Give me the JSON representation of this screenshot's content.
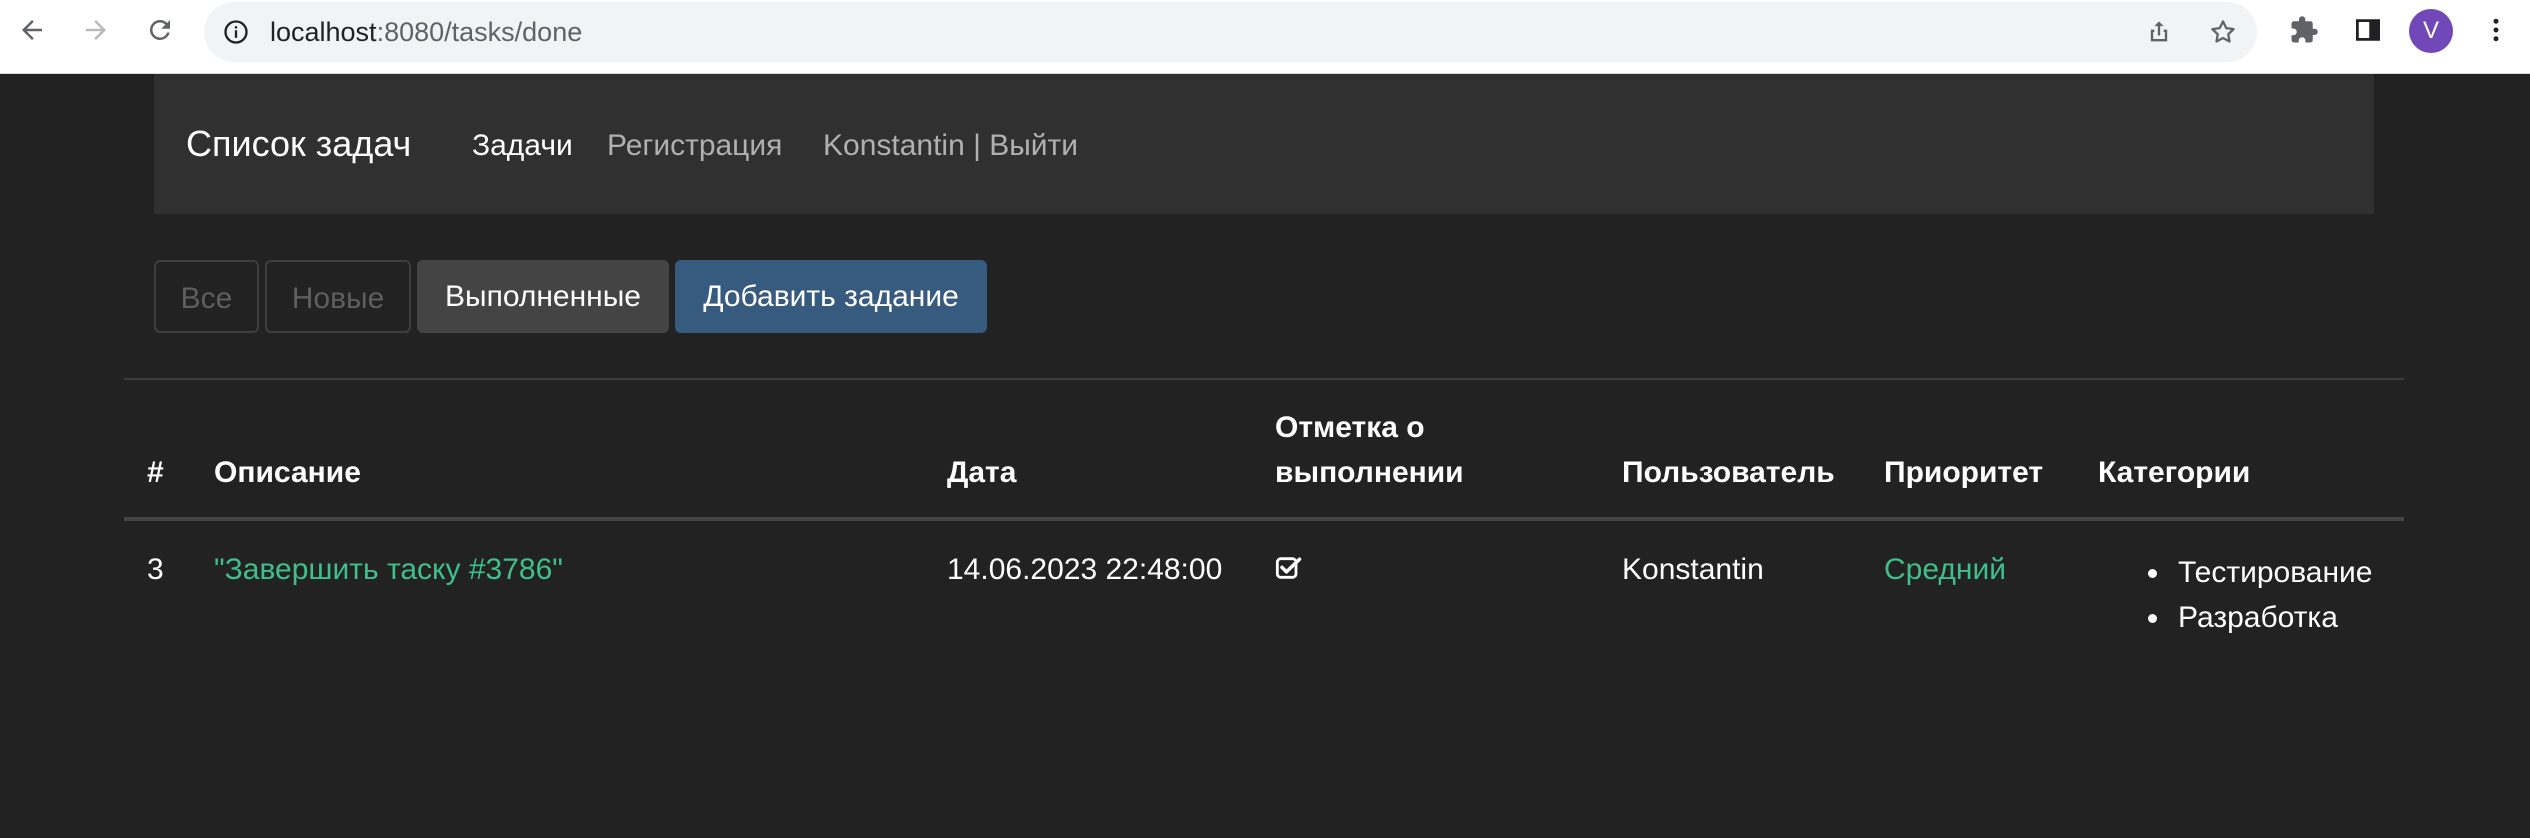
{
  "browser": {
    "url_host": "localhost",
    "url_path": ":8080/tasks/done",
    "profile_initial": "V",
    "icons": [
      "back-arrow-icon",
      "forward-arrow-icon",
      "reload-icon",
      "site-info-icon",
      "share-icon",
      "bookmark-star-icon",
      "extensions-puzzle-icon",
      "side-panel-icon",
      "menu-dots-icon"
    ]
  },
  "navbar": {
    "brand": "Список задач",
    "links": [
      {
        "label": "Задачи",
        "active": true
      },
      {
        "label": "Регистрация",
        "active": false
      },
      {
        "label": "Konstantin | Выйти",
        "active": false
      }
    ]
  },
  "filters": {
    "all": "Все",
    "new": "Новые",
    "done": "Выполненные",
    "add": "Добавить задание"
  },
  "table": {
    "headers": {
      "num": "#",
      "description": "Описание",
      "date": "Дата",
      "done_mark_line1": "Отметка о",
      "done_mark_line2": "выполнении",
      "user": "Пользователь",
      "priority": "Приоритет",
      "categories": "Категории"
    },
    "rows": [
      {
        "num": "3",
        "description": "\"Завершить таску #3786\"",
        "date": "14.06.2023 22:48:00",
        "done": true,
        "user": "Konstantin",
        "priority": "Средний",
        "categories": [
          "Тестирование",
          "Разработка"
        ]
      }
    ]
  },
  "colors": {
    "background": "#222222",
    "navbar": "#303030",
    "primary": "#375a7f",
    "success_link": "#3fbf8c",
    "avatar": "#7248b9"
  }
}
